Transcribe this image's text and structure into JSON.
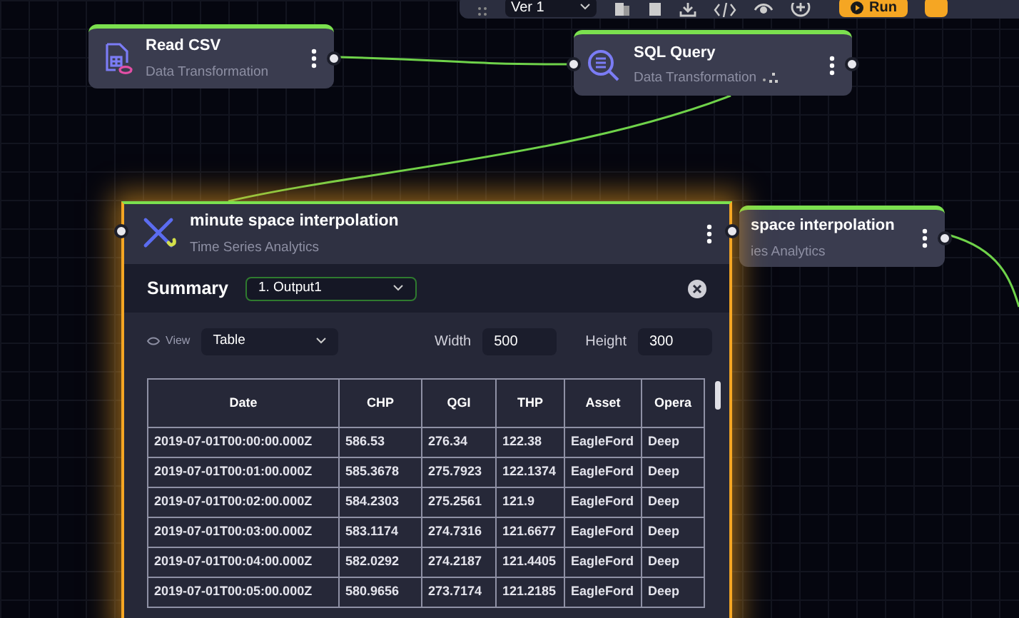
{
  "toolbar": {
    "version": "Ver 1",
    "run": "Run"
  },
  "nodes": [
    {
      "title": "Read CSV",
      "category": "Data Transformation"
    },
    {
      "title": "SQL Query",
      "category": "Data Transformation"
    },
    {
      "title": "space interpolation",
      "category": "ies Analytics"
    }
  ],
  "main_node": {
    "title": "minute space interpolation",
    "category": "Time Series Analytics",
    "summary": {
      "title": "Summary",
      "output": "1. Output1"
    },
    "view": {
      "label": "View",
      "value": "Table"
    },
    "width": {
      "label": "Width",
      "value": "500"
    },
    "height": {
      "label": "Height",
      "value": "300"
    },
    "table": {
      "columns": [
        "Date",
        "CHP",
        "QGI",
        "THP",
        "Asset",
        "Opera"
      ],
      "rows": [
        [
          "2019-07-01T00:00:00.000Z",
          "586.53",
          "276.34",
          "122.38",
          "EagleFord",
          "Deep"
        ],
        [
          "2019-07-01T00:01:00.000Z",
          "585.3678",
          "275.7923",
          "122.1374",
          "EagleFord",
          "Deep"
        ],
        [
          "2019-07-01T00:02:00.000Z",
          "584.2303",
          "275.2561",
          "121.9",
          "EagleFord",
          "Deep"
        ],
        [
          "2019-07-01T00:03:00.000Z",
          "583.1174",
          "274.7316",
          "121.6677",
          "EagleFord",
          "Deep"
        ],
        [
          "2019-07-01T00:04:00.000Z",
          "582.0292",
          "274.2187",
          "121.4405",
          "EagleFord",
          "Deep"
        ],
        [
          "2019-07-01T00:05:00.000Z",
          "580.9656",
          "273.7174",
          "121.2185",
          "EagleFord",
          "Deep"
        ]
      ]
    }
  }
}
